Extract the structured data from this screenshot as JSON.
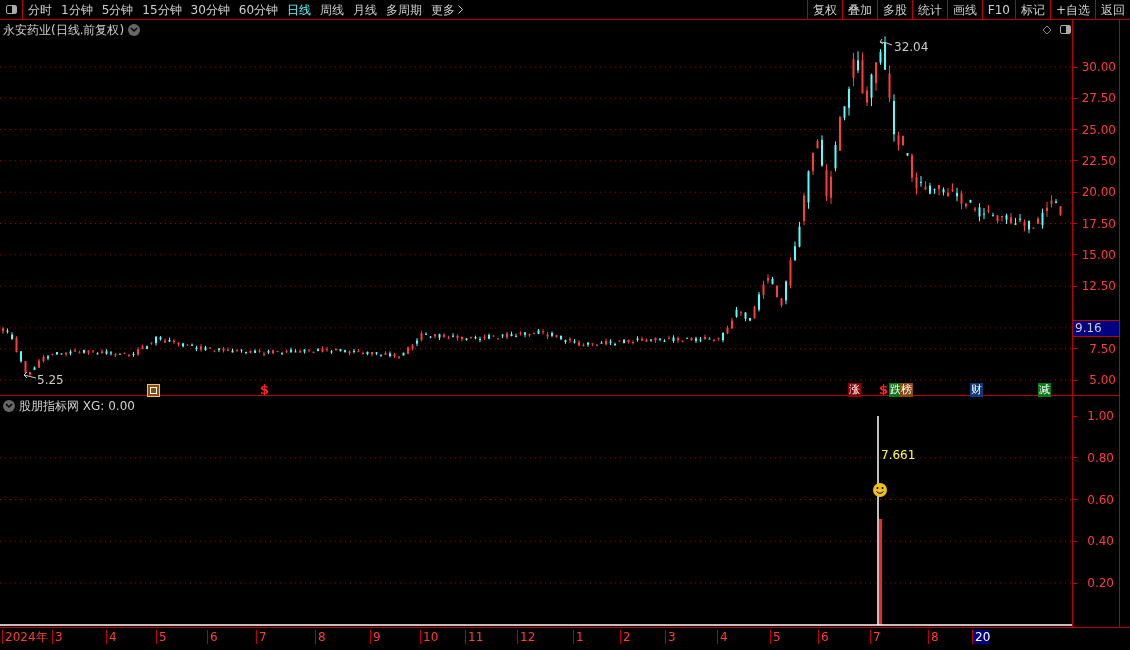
{
  "toolbar": {
    "periods": [
      {
        "label": "分时",
        "selected": false
      },
      {
        "label": "1分钟",
        "selected": false
      },
      {
        "label": "5分钟",
        "selected": false
      },
      {
        "label": "15分钟",
        "selected": false
      },
      {
        "label": "30分钟",
        "selected": false
      },
      {
        "label": "60分钟",
        "selected": false
      },
      {
        "label": "日线",
        "selected": true
      },
      {
        "label": "周线",
        "selected": false
      },
      {
        "label": "月线",
        "selected": false
      },
      {
        "label": "多周期",
        "selected": false
      },
      {
        "label": "更多",
        "selected": false
      }
    ],
    "actions": [
      "复权",
      "叠加",
      "多股",
      "统计",
      "画线",
      "F10",
      "标记",
      "+自选",
      "返回"
    ]
  },
  "main_chart": {
    "title": "永安药业(日线.前复权)",
    "high_label": "32.04",
    "low_label": "5.25",
    "current_price": "9.16",
    "y_axis": [
      "30.00",
      "27.50",
      "25.00",
      "22.50",
      "20.00",
      "17.50",
      "15.00",
      "12.50",
      "7.50",
      "5.00"
    ],
    "markers": [
      {
        "kind": "icon"
      },
      {
        "kind": "text",
        "label": "$"
      },
      {
        "kind": "tag",
        "label": "涨",
        "color": "#8b0000"
      },
      {
        "kind": "text",
        "label": "$"
      },
      {
        "kind": "tag",
        "label": "跌",
        "color": "#0a7a16"
      },
      {
        "kind": "tag",
        "label": "榜",
        "color": "#8a4a10"
      },
      {
        "kind": "tag",
        "label": "财",
        "color": "#0a3a7a"
      },
      {
        "kind": "tag",
        "label": "减",
        "color": "#0a7a16"
      }
    ]
  },
  "indicator": {
    "title": "股朋指标网 XG: 0.00",
    "value_label": "7.661",
    "y_axis": [
      "1.00",
      "0.80",
      "0.60",
      "0.40",
      "0.20"
    ]
  },
  "date_axis": [
    {
      "label": "2024年",
      "selected": false
    },
    {
      "label": "3",
      "selected": false
    },
    {
      "label": "4",
      "selected": false
    },
    {
      "label": "5",
      "selected": false
    },
    {
      "label": "6",
      "selected": false
    },
    {
      "label": "7",
      "selected": false
    },
    {
      "label": "8",
      "selected": false
    },
    {
      "label": "9",
      "selected": false
    },
    {
      "label": "10",
      "selected": false
    },
    {
      "label": "11",
      "selected": false
    },
    {
      "label": "12",
      "selected": false
    },
    {
      "label": "1",
      "selected": false
    },
    {
      "label": "2",
      "selected": false
    },
    {
      "label": "3",
      "selected": false
    },
    {
      "label": "4",
      "selected": false
    },
    {
      "label": "5",
      "selected": false
    },
    {
      "label": "6",
      "selected": false
    },
    {
      "label": "7",
      "selected": false
    },
    {
      "label": "8",
      "selected": false
    },
    {
      "label": "20",
      "selected": true
    }
  ]
}
